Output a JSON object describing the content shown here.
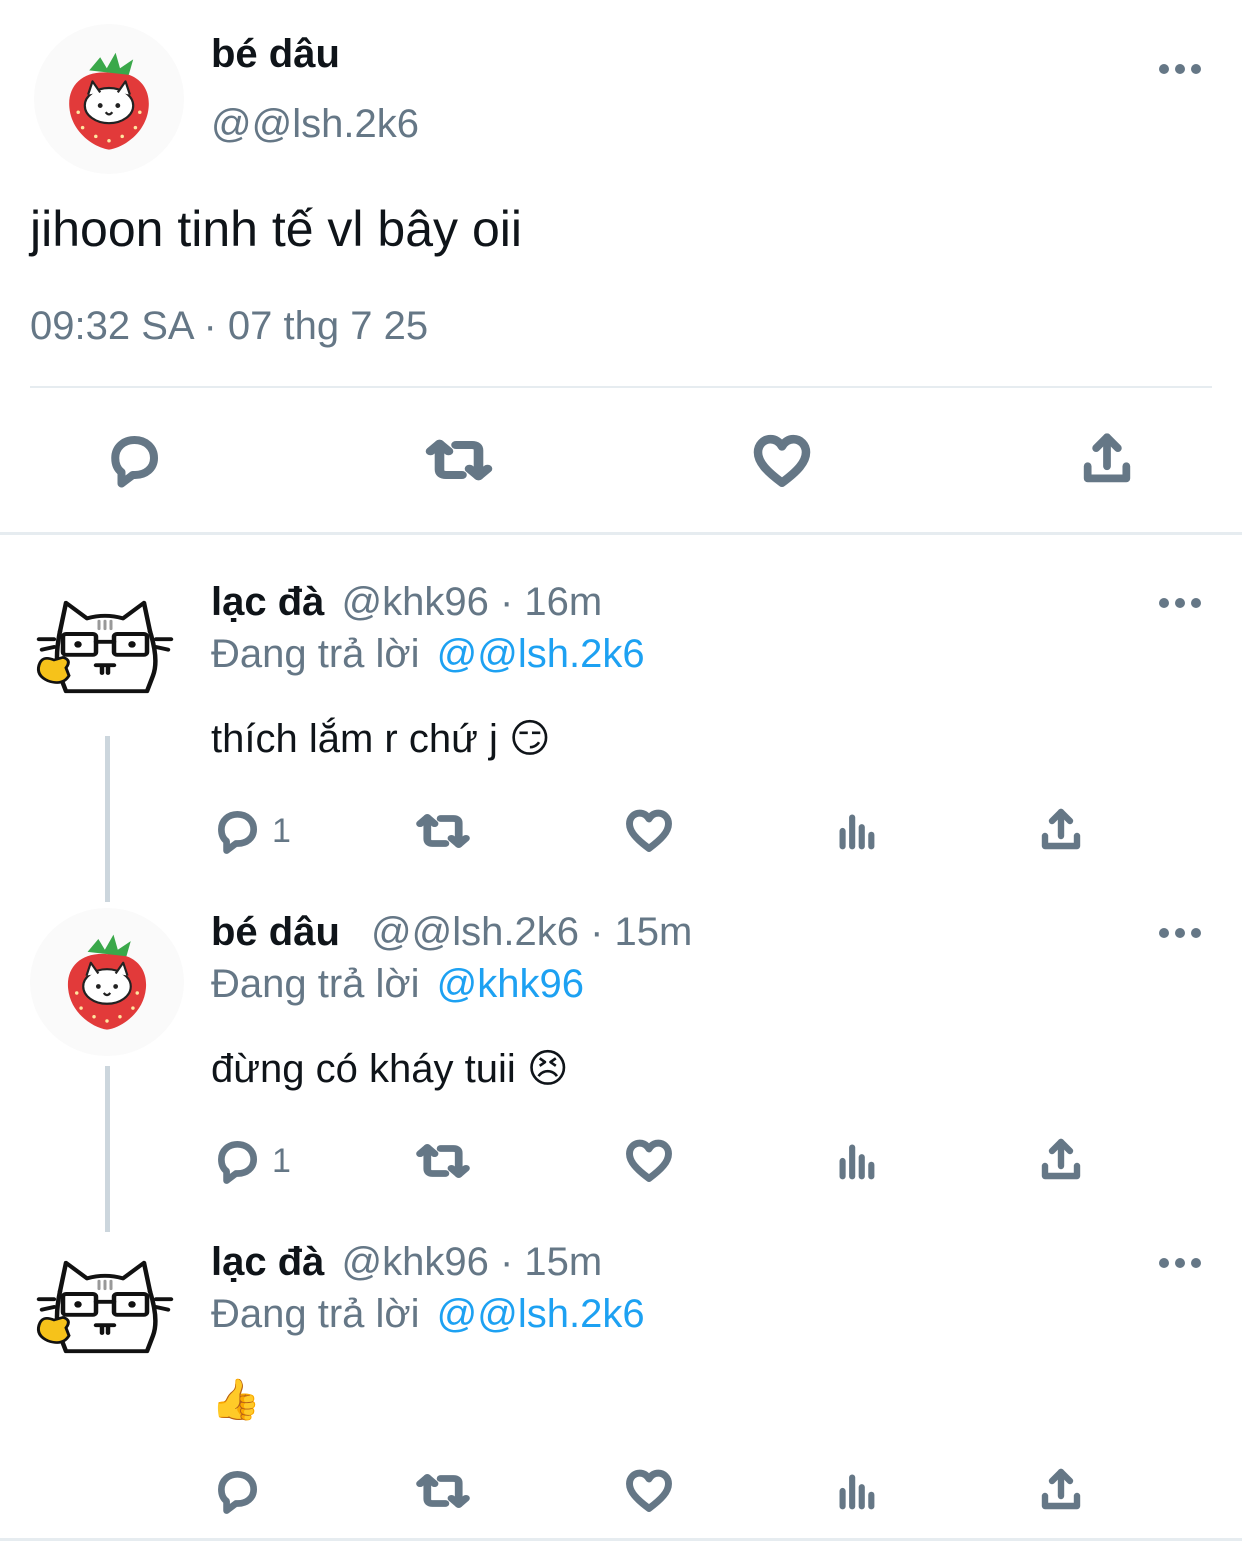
{
  "main_tweet": {
    "display_name": "bé dâu",
    "handle": "@@lsh.2k6",
    "text": "jihoon tinh tế vl bây oii",
    "timestamp": "09:32 SA · 07 thg 7 25",
    "avatar_icon": "strawberry-cat-icon"
  },
  "replies": [
    {
      "display_name": "lạc đà",
      "handle": "@khk96",
      "age": "· 16m",
      "replying_prefix": "Đang trả lời",
      "replying_to": "@@lsh.2k6",
      "text": "thích lắm r chứ j 😏",
      "reply_count": "1",
      "avatar_icon": "glasses-cat-icon"
    },
    {
      "display_name": "bé dâu",
      "handle": "@@lsh.2k6",
      "age": "· 15m",
      "replying_prefix": "Đang trả lời",
      "replying_to": "@khk96",
      "text": "đừng có kháy tuii 😣",
      "reply_count": "1",
      "avatar_icon": "strawberry-cat-icon"
    },
    {
      "display_name": "lạc đà",
      "handle": "@khk96",
      "age": "· 15m",
      "replying_prefix": "Đang trả lời",
      "replying_to": "@@lsh.2k6",
      "text": "👍",
      "reply_count": "",
      "avatar_icon": "glasses-cat-icon"
    }
  ],
  "colors": {
    "text": "#0f1419",
    "secondary": "#657786",
    "link": "#1da1f2",
    "divider": "#e6ecf0"
  }
}
